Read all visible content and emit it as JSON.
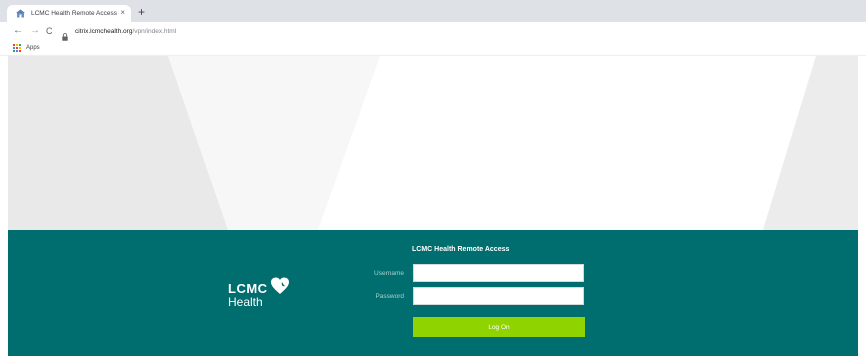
{
  "browser": {
    "tab_title": "LCMC Health Remote Access",
    "tab_close": "×",
    "new_tab": "+",
    "back": "←",
    "forward": "→",
    "reload": "C",
    "url_host": "citrix.lcmchealth.org",
    "url_path": "/vpn/index.html",
    "bookmarks": {
      "apps_label": "Apps"
    },
    "icons": [
      "lock-icon",
      "apps-grid-icon",
      "favicon"
    ]
  },
  "logo": {
    "line1": "LCMC",
    "line2": "Health"
  },
  "form": {
    "title": "LCMC Health Remote Access",
    "username_label": "Username",
    "username_value": "",
    "password_label": "Password",
    "password_value": "",
    "submit_label": "Log On"
  },
  "colors": {
    "panel": "#006e6e",
    "button": "#8fd400",
    "hero": "#f3f3f4",
    "logo_heart": "#ffffff"
  }
}
